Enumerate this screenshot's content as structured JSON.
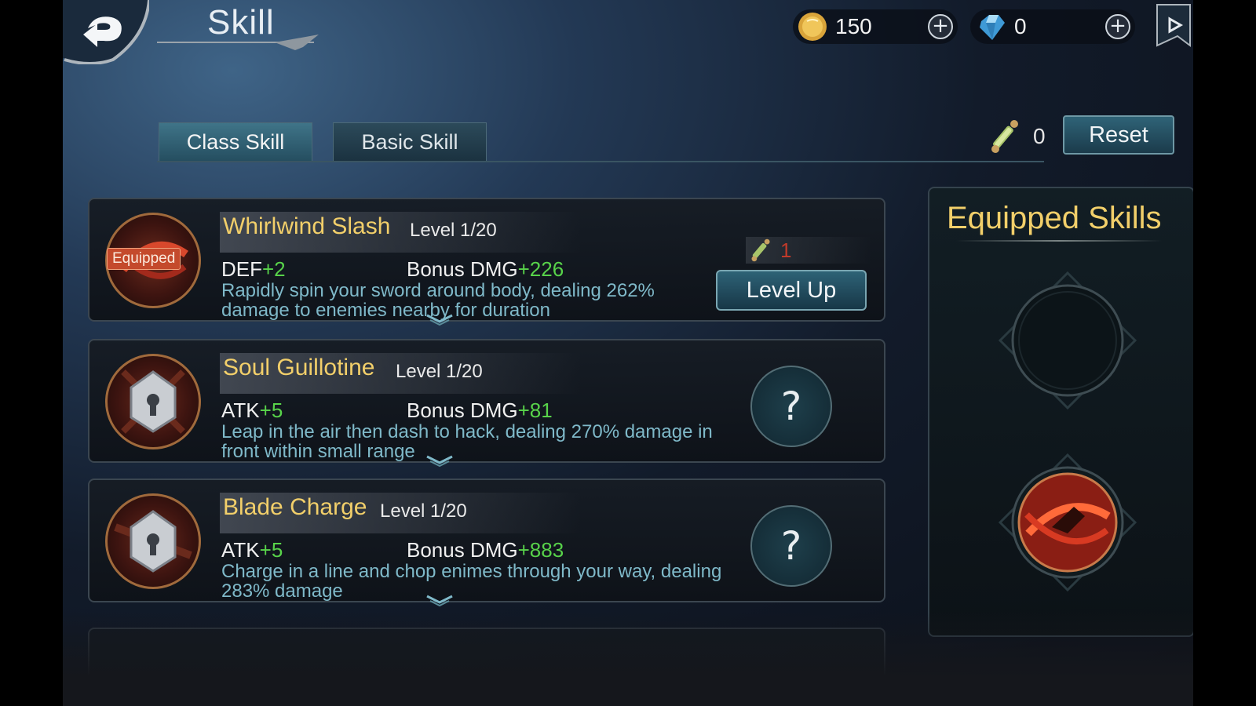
{
  "header": {
    "title": "Skill",
    "gold": "150",
    "gems": "0"
  },
  "tabs": [
    {
      "label": "Class Skill",
      "active": true
    },
    {
      "label": "Basic Skill",
      "active": false
    }
  ],
  "skill_scrolls": "0",
  "reset_label": "Reset",
  "skills": [
    {
      "name": "Whirlwind Slash",
      "level": "Level 1/20",
      "stat1_label": "DEF",
      "stat1_value": "+2",
      "stat2_label": "Bonus DMG",
      "stat2_value": "+226",
      "description": "Rapidly spin your sword around body, dealing 262% damage to enemies nearby for duration",
      "badge": "Equipped",
      "levelup_cost": "1",
      "levelup_label": "Level Up"
    },
    {
      "name": "Soul Guillotine",
      "level": "Level 1/20",
      "stat1_label": "ATK",
      "stat1_value": "+5",
      "stat2_label": "Bonus DMG",
      "stat2_value": "+81",
      "description": "Leap in the air then dash to hack, dealing 270% damage in front within small range",
      "help": "?"
    },
    {
      "name": "Blade Charge",
      "level": "Level 1/20",
      "stat1_label": "ATK",
      "stat1_value": "+5",
      "stat2_label": "Bonus DMG",
      "stat2_value": "+883",
      "description": "Charge in a line and chop enimes through your way, dealing 283% damage",
      "help": "?"
    }
  ],
  "equipped_panel": {
    "title": "Equipped Skills"
  },
  "colors": {
    "gold_text": "#f2cf6a",
    "stat_bonus": "#58d34a",
    "description": "#7fb9c9",
    "button": "#2e6276"
  }
}
